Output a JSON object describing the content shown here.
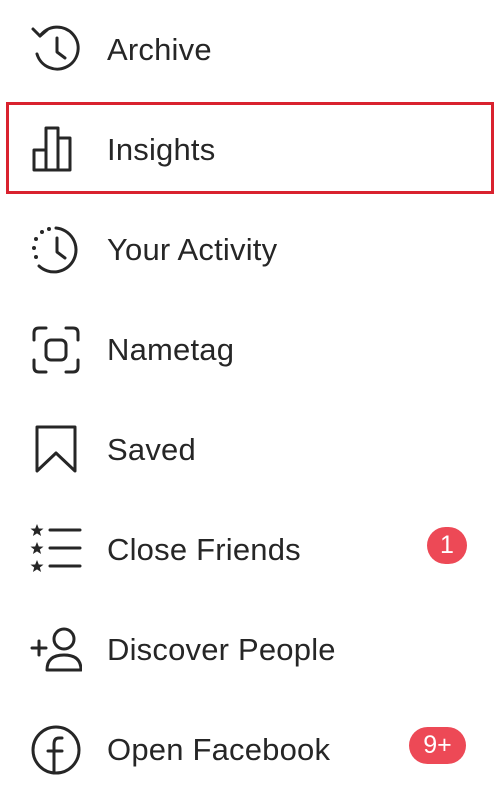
{
  "menu": {
    "items": [
      {
        "label": "Archive",
        "icon": "archive-icon"
      },
      {
        "label": "Insights",
        "icon": "insights-icon"
      },
      {
        "label": "Your Activity",
        "icon": "activity-icon"
      },
      {
        "label": "Nametag",
        "icon": "nametag-icon"
      },
      {
        "label": "Saved",
        "icon": "bookmark-icon"
      },
      {
        "label": "Close Friends",
        "icon": "close-friends-icon",
        "badge": "1"
      },
      {
        "label": "Discover People",
        "icon": "add-person-icon"
      },
      {
        "label": "Open Facebook",
        "icon": "facebook-icon",
        "badge": "9+"
      }
    ]
  },
  "colors": {
    "text": "#262626",
    "badge": "#ed4956",
    "highlight": "#d9222e"
  }
}
